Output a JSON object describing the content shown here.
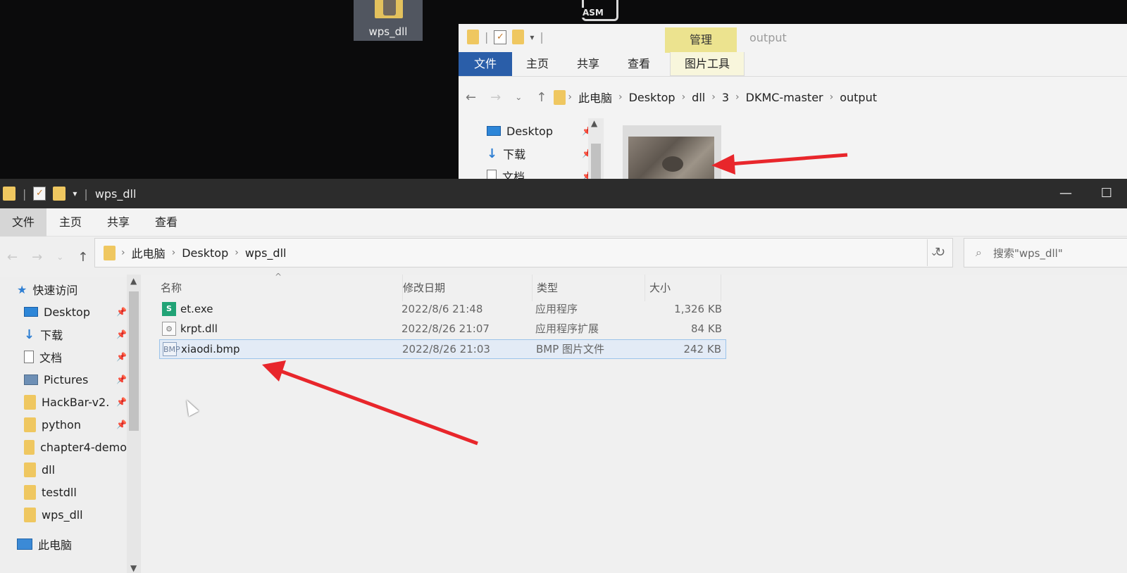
{
  "desktop": {
    "icon_wps": "wps_dll",
    "icon_asm": "ASM"
  },
  "back_window": {
    "context_tab": "管理",
    "title": "output",
    "tabs": [
      "文件",
      "主页",
      "共享",
      "查看"
    ],
    "context_subtab": "图片工具",
    "path": [
      "此电脑",
      "Desktop",
      "dll",
      "3",
      "DKMC-master",
      "output"
    ],
    "nav": [
      {
        "label": "Desktop",
        "icon": "desktop-icon"
      },
      {
        "label": "下载",
        "icon": "download-icon"
      },
      {
        "label": "文档",
        "icon": "document-icon"
      }
    ]
  },
  "main_window": {
    "title": "wps_dll",
    "tabs": [
      "文件",
      "主页",
      "共享",
      "查看"
    ],
    "path": [
      "此电脑",
      "Desktop",
      "wps_dll"
    ],
    "search_placeholder": "搜索\"wps_dll\"",
    "sidebar": {
      "quick_access": "快速访问",
      "items": [
        {
          "label": "Desktop",
          "icon": "desktop-icon",
          "pinned": true
        },
        {
          "label": "下载",
          "icon": "download-icon",
          "pinned": true
        },
        {
          "label": "文档",
          "icon": "document-icon",
          "pinned": true
        },
        {
          "label": "Pictures",
          "icon": "pictures-icon",
          "pinned": true
        },
        {
          "label": "HackBar-v2.",
          "icon": "folder-icon",
          "pinned": true
        },
        {
          "label": "python",
          "icon": "folder-icon",
          "pinned": true
        },
        {
          "label": "chapter4-demo",
          "icon": "folder-icon",
          "pinned": false
        },
        {
          "label": "dll",
          "icon": "folder-icon",
          "pinned": false
        },
        {
          "label": "testdll",
          "icon": "folder-icon",
          "pinned": false
        },
        {
          "label": "wps_dll",
          "icon": "folder-icon",
          "pinned": false
        }
      ],
      "this_pc": "此电脑"
    },
    "columns": [
      "名称",
      "修改日期",
      "类型",
      "大小"
    ],
    "files": [
      {
        "name": "et.exe",
        "date": "2022/8/6 21:48",
        "type": "应用程序",
        "size": "1,326 KB",
        "icon": "exe-icon",
        "icon_text": "S"
      },
      {
        "name": "krpt.dll",
        "date": "2022/8/26 21:07",
        "type": "应用程序扩展",
        "size": "84 KB",
        "icon": "dll-icon",
        "icon_text": "⚙"
      },
      {
        "name": "xiaodi.bmp",
        "date": "2022/8/26 21:03",
        "type": "BMP 图片文件",
        "size": "242 KB",
        "icon": "bmp-icon",
        "icon_text": "BMP"
      }
    ]
  },
  "colors": {
    "file_tab": "#2a5ea9",
    "manage_tab": "#ece38f",
    "arrow": "#e8262b",
    "selection": "#e3ebf6"
  }
}
